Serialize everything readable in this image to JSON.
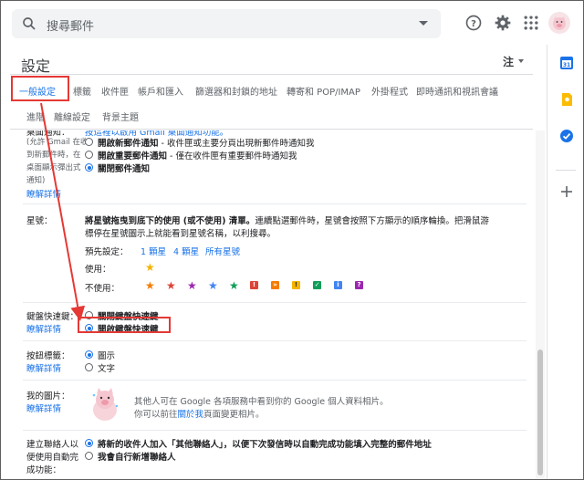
{
  "search": {
    "placeholder": "搜尋郵件"
  },
  "settings": {
    "title": "設定",
    "density_label": "注"
  },
  "tabs": {
    "row1": [
      "一般設定",
      "標籤",
      "收件匣",
      "帳戶和匯入",
      "篩選器和封鎖的地址",
      "轉寄和 POP/IMAP",
      "外掛程式",
      "即時通訊和視訊會議"
    ],
    "row2": [
      "進階",
      "離線設定",
      "背景主題"
    ]
  },
  "desktop_notifications": {
    "label_partial": "桌面通知：",
    "top_link_partial": "按這裡以啟用 Gmail 桌面通知功能。",
    "side_note": [
      "(允許 Gmail 在收",
      "到新郵件時，在",
      "桌面顯示彈出式",
      "通知)"
    ],
    "learn_more": "瞭解詳情",
    "options": [
      {
        "label": "開啟新郵件通知",
        "desc": " - 收件匣或主要分頁出現新郵件時通知我"
      },
      {
        "label": "開啟重要郵件通知",
        "desc": " - 僅在收件匣有重要郵件時通知我"
      },
      {
        "label": "關閉郵件通知",
        "desc": ""
      }
    ]
  },
  "stars": {
    "label": "星號：",
    "desc_bold": "將星號拖曳到底下的使用 (或不使用) 清單。",
    "desc_rest": "連續點選郵件時，星號會按照下方顯示的順序輪換。把滑鼠游",
    "desc_line2": "標停在星號圖示上就能看到星號名稱，以利搜尋。",
    "presets_label": "預先設定：",
    "presets": [
      "1 顆星",
      "4 顆星",
      "所有星號"
    ],
    "in_use_label": "使用：",
    "not_in_use_label": "不使用：",
    "colors": {
      "yellow": "#f4b400",
      "orange": "#f57c00",
      "red": "#db4437",
      "purple": "#9c27b0",
      "blue": "#4285f4",
      "green": "#0f9d58"
    },
    "not_in_use_icons": [
      "star-orange",
      "star-red",
      "star-purple",
      "star-blue",
      "star-green",
      "bang-red",
      "guillemet-orange",
      "bang-yellow",
      "check-green",
      "info-blue",
      "question-purple"
    ],
    "icon_glyphs": {
      "bang": "!",
      "guillemet": "»",
      "check": "✓",
      "info": "i",
      "question": "?"
    }
  },
  "shortcuts": {
    "label": "鍵盤快速鍵：",
    "learn_more": "瞭解詳情",
    "options": [
      "關閉鍵盤快速鍵",
      "開啟鍵盤快速鍵"
    ]
  },
  "button_labels": {
    "label": "按鈕標籤：",
    "learn_more": "瞭解詳情",
    "options": [
      "圖示",
      "文字"
    ]
  },
  "my_picture": {
    "label": "我的圖片：",
    "learn_more": "瞭解詳情",
    "line1": "其他人可在 Google 各項服務中看到你的 Google 個人資料相片。",
    "line2_pre": "你可以前往",
    "line2_link": "關於我",
    "line2_post": "頁面變更相片。"
  },
  "contacts": {
    "label_lines": [
      "建立聯絡人以",
      "便使用自動完",
      "成功能："
    ],
    "options": [
      {
        "bold": "將新的收件人加入「其他聯絡人」，以便下次發信時以自動完成功能填入完整的郵件地址"
      },
      {
        "bold": "我會自行新增聯絡人"
      }
    ]
  },
  "colors": {
    "accent": "#1a73e8",
    "annotation_red": "#e53935"
  }
}
